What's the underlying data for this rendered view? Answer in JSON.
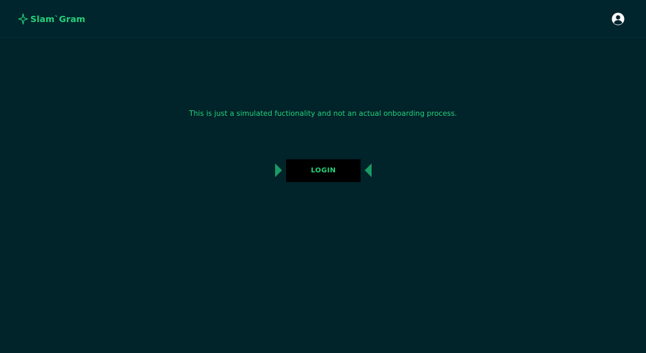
{
  "header": {
    "brand_name": "Slam`Gram",
    "brand_icon": "sparkle-icon",
    "account_icon": "user-circle-icon"
  },
  "main": {
    "notice": "This is just a simulated fuctionality and not an actual onboarding process.",
    "login_label": "LOGIN",
    "arrow_icons": [
      "triangle-right-icon",
      "triangle-left-icon"
    ]
  },
  "colors": {
    "background": "#01232a",
    "accent": "#23d17a",
    "arrow": "#1a9a64",
    "button": "#000000"
  }
}
